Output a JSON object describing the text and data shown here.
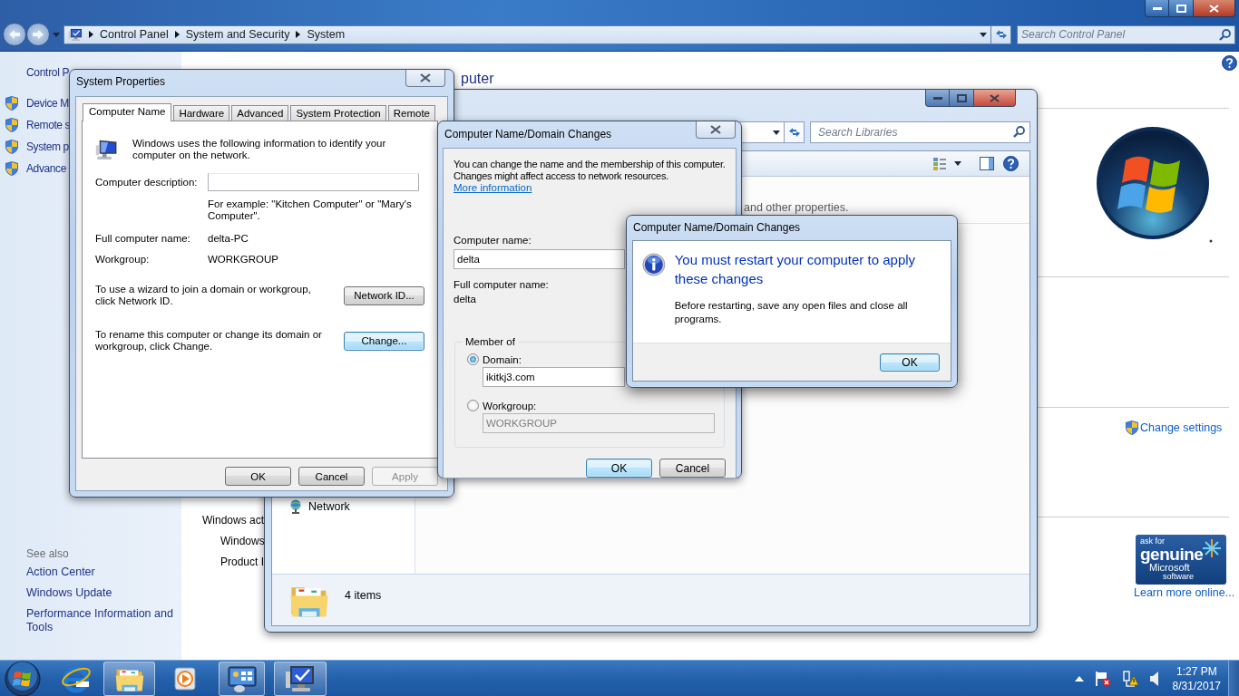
{
  "address_bar": {
    "breadcrumbs": [
      "Control Panel",
      "System and Security",
      "System"
    ],
    "search_placeholder": "Search Control Panel"
  },
  "sidebar": {
    "home": "Control P",
    "links": [
      "Device M",
      "Remote s",
      "System p",
      "Advance"
    ],
    "see_also": {
      "title": "See also",
      "links": [
        "Action Center",
        "Windows Update",
        "Performance Information and Tools"
      ]
    }
  },
  "main": {
    "heading": "puter",
    "fragments": [
      "Windows act",
      "Windows",
      "Product I"
    ],
    "change_settings": "Change settings",
    "genuine": {
      "lines": [
        "ask for",
        "genuine",
        "Microsoft",
        "software"
      ],
      "link": "Learn more online..."
    }
  },
  "libraries_window": {
    "search_placeholder": "Search Libraries",
    "content_fragment": "and other properties.",
    "nav_items": [
      "Network"
    ],
    "status": "4 items"
  },
  "system_properties": {
    "title": "System Properties",
    "tabs": [
      {
        "label": "Computer Name",
        "selected": true
      },
      {
        "label": "Hardware",
        "selected": false
      },
      {
        "label": "Advanced",
        "selected": false
      },
      {
        "label": "System Protection",
        "selected": false
      },
      {
        "label": "Remote",
        "selected": false
      }
    ],
    "intro": "Windows uses the following information to identify your computer on the network.",
    "description_label": "Computer description:",
    "example": "For example: \"Kitchen Computer\" or \"Mary's Computer\".",
    "fields": [
      {
        "label": "Full computer name:",
        "value": "delta-PC"
      },
      {
        "label": "Workgroup:",
        "value": "WORKGROUP"
      }
    ],
    "actions": [
      {
        "text": "To use a wizard to join a domain or workgroup, click Network ID.",
        "button": "Network ID...",
        "focused": false
      },
      {
        "text": "To rename this computer or change its domain or workgroup, click Change.",
        "button": "Change...",
        "focused": true
      }
    ],
    "buttons": [
      {
        "label": "OK",
        "disabled": false
      },
      {
        "label": "Cancel",
        "disabled": false
      },
      {
        "label": "Apply",
        "disabled": true
      }
    ]
  },
  "domain_dialog": {
    "title": "Computer Name/Domain Changes",
    "intro": "You can change the name and the membership of this computer. Changes might affect access to network resources.",
    "link": "More information",
    "name_label": "Computer name:",
    "name_value": "delta",
    "full_label": "Full computer name:",
    "full_value": "delta",
    "member_of": "Member of",
    "options": [
      {
        "label": "Domain:",
        "selected": true,
        "value": "ikitkj3.com"
      },
      {
        "label": "Workgroup:",
        "selected": false,
        "value": "WORKGROUP"
      }
    ],
    "buttons": [
      {
        "label": "OK",
        "focused": true
      },
      {
        "label": "Cancel",
        "focused": false
      }
    ]
  },
  "message_box": {
    "title": "Computer Name/Domain Changes",
    "heading": "You must restart your computer to apply these changes",
    "body": "Before restarting, save any open files and close all programs.",
    "button": "OK"
  },
  "taskbar": {
    "apps": [
      {
        "kind": "browser",
        "open": false
      },
      {
        "kind": "folder",
        "open": true
      },
      {
        "kind": "media",
        "open": false
      },
      {
        "kind": "control-panel",
        "open": true
      },
      {
        "kind": "system",
        "open": true
      }
    ],
    "clock": {
      "time": "1:27 PM",
      "date": "8/31/2017"
    }
  }
}
